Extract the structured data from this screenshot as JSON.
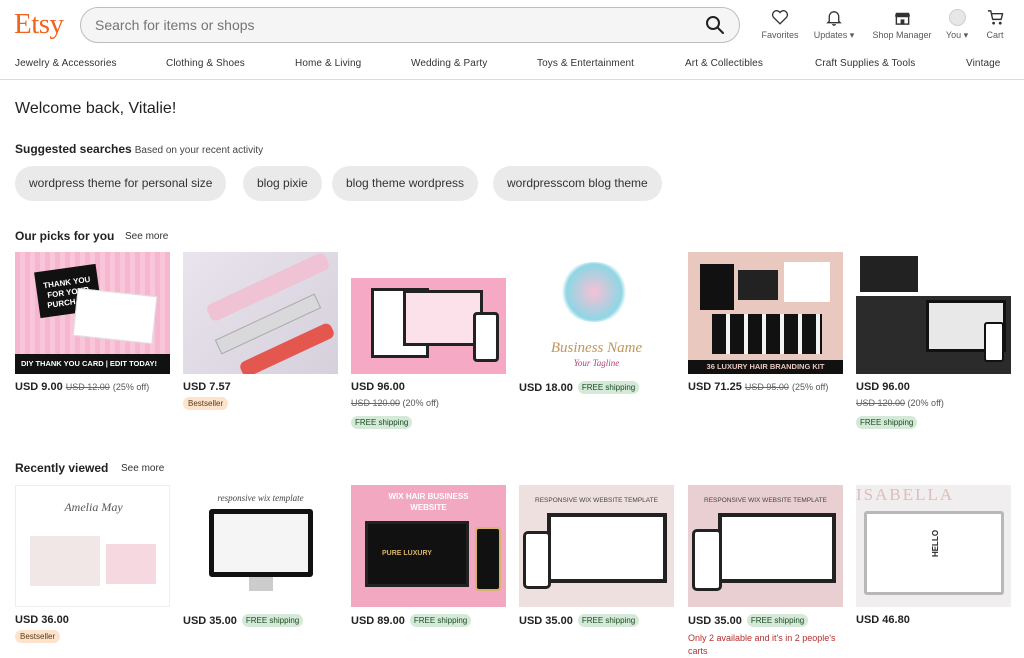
{
  "header": {
    "logo": "Etsy",
    "search_placeholder": "Search for items or shops",
    "nav": [
      {
        "label": "Favorites",
        "icon": "heart-icon"
      },
      {
        "label": "Updates ▾",
        "icon": "bell-icon"
      },
      {
        "label": "Shop Manager",
        "icon": "shop-icon"
      },
      {
        "label": "You ▾",
        "icon": "avatar-icon"
      },
      {
        "label": "Cart",
        "icon": "cart-icon"
      }
    ]
  },
  "categories": [
    "Jewelry & Accessories",
    "Clothing & Shoes",
    "Home & Living",
    "Wedding & Party",
    "Toys & Entertainment",
    "Art & Collectibles",
    "Craft Supplies & Tools",
    "Vintage"
  ],
  "welcome": "Welcome back, Vitalie!",
  "suggested": {
    "title": "Suggested searches",
    "subtitle": "Based on your recent activity",
    "chips": [
      "wordpress theme for personal size",
      "blog pixie",
      "blog theme wordpress",
      "wordpresscom blog theme"
    ]
  },
  "picks": {
    "title": "Our picks for you",
    "see_more": "See more",
    "items": [
      {
        "price": "USD 9.00",
        "old": "USD 12.00",
        "discount": "(25% off)",
        "thumb_text": "DIY THANK YOU CARD | EDIT TODAY!",
        "card_text": "THANK YOU FOR YOUR PURCHASE"
      },
      {
        "price": "USD 7.57",
        "badge": "Bestseller"
      },
      {
        "price": "USD 96.00",
        "old": "USD 120.00",
        "discount": "(20% off)",
        "shipping": "FREE shipping"
      },
      {
        "price": "USD 18.00",
        "shipping": "FREE shipping",
        "thumb_text": "Business Name",
        "thumb_sub": "Your Tagline"
      },
      {
        "price": "USD 71.25",
        "old": "USD 95.00",
        "discount": "(25% off)",
        "thumb_text": "36 LUXURY HAIR BRANDING KIT"
      },
      {
        "price": "USD 96.00",
        "old": "USD 120.00",
        "discount": "(20% off)",
        "shipping": "FREE shipping"
      }
    ]
  },
  "recent": {
    "title": "Recently viewed",
    "see_more": "See more",
    "items": [
      {
        "price": "USD 36.00",
        "badge": "Bestseller",
        "thumb_text": "Amelia May"
      },
      {
        "price": "USD 35.00",
        "shipping": "FREE shipping",
        "thumb_text": "responsive wix template"
      },
      {
        "price": "USD 89.00",
        "shipping": "FREE shipping",
        "thumb_text": "WIX HAIR BUSINESS WEBSITE",
        "thumb_sub": "PURE LUXURY"
      },
      {
        "price": "USD 35.00",
        "shipping": "FREE shipping",
        "thumb_text": "RESPONSIVE WIX WEBSITE TEMPLATE"
      },
      {
        "price": "USD 35.00",
        "shipping": "FREE shipping",
        "thumb_text": "RESPONSIVE WIX WEBSITE TEMPLATE",
        "note": "Only 2 available and it's in 2 people's carts"
      },
      {
        "price": "USD 46.80",
        "thumb_text": "ISABELLA",
        "thumb_sub": "HELLO"
      }
    ]
  },
  "colors": {
    "brand": "#F1641E",
    "chip": "#eaeaea",
    "free_shipping": "#d4e9d7",
    "bestseller": "#fde3cc"
  }
}
